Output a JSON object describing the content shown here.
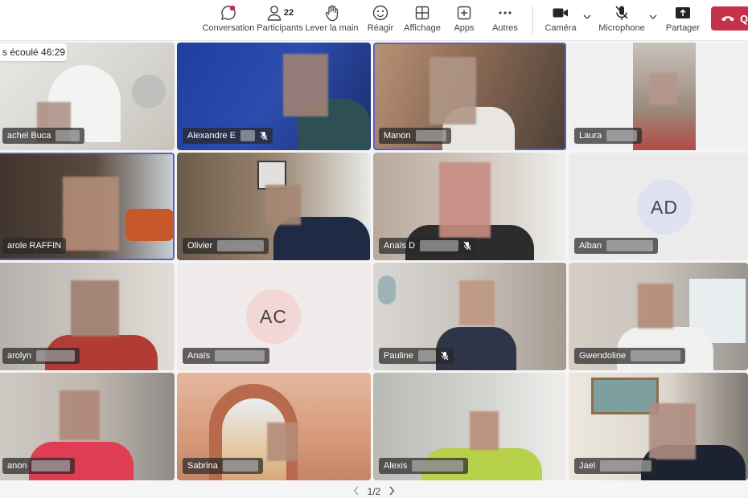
{
  "toolbar": {
    "conversation": "Conversation",
    "participants": "Participants",
    "participants_count": "22",
    "raise_hand": "Lever la main",
    "react": "Réagir",
    "view": "Affichage",
    "apps": "Apps",
    "more": "Autres",
    "camera": "Caméra",
    "microphone": "Microphone",
    "share": "Partager",
    "leave": "Q"
  },
  "timer": "s écoulé 46:29",
  "tiles": [
    {
      "name": "achel Buca"
    },
    {
      "name": "Alexandre E"
    },
    {
      "name": "Manon"
    },
    {
      "name": "Laura"
    },
    {
      "name": "arole RAFFIN"
    },
    {
      "name": "Olivier"
    },
    {
      "name": "Anaïs D"
    },
    {
      "name": "Alban",
      "initials": "AD"
    },
    {
      "name": "arolyn"
    },
    {
      "name": "Anaïs",
      "initials": "AC"
    },
    {
      "name": "Pauline"
    },
    {
      "name": "Gwendoline"
    },
    {
      "name": "anon"
    },
    {
      "name": "Sabrina"
    },
    {
      "name": "Alexis"
    },
    {
      "name": "Jael"
    }
  ],
  "pager": {
    "label": "1/2"
  },
  "colors": {
    "accent": "#5b5fc7",
    "leave": "#c4314b",
    "notification": "#c4314b"
  }
}
